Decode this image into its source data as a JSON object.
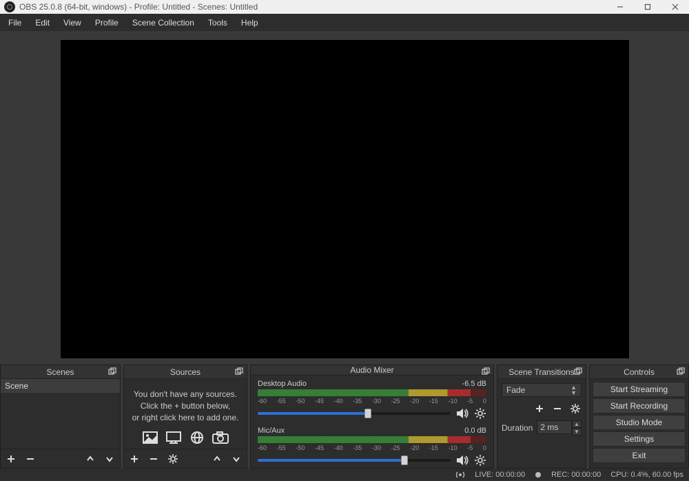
{
  "titlebar": {
    "title": "OBS 25.0.8 (64-bit, windows) - Profile: Untitled - Scenes: Untitled"
  },
  "menu": [
    "File",
    "Edit",
    "View",
    "Profile",
    "Scene Collection",
    "Tools",
    "Help"
  ],
  "panels": {
    "scenes": {
      "title": "Scenes",
      "items": [
        "Scene"
      ]
    },
    "sources": {
      "title": "Sources",
      "empty_lines": [
        "You don't have any sources.",
        "Click the + button below,",
        "or right click here to add one."
      ]
    },
    "mixer": {
      "title": "Audio Mixer",
      "tracks": [
        {
          "name": "Desktop Audio",
          "db": "-6.5 dB",
          "fill_pct": 57,
          "thumb_pct": 57
        },
        {
          "name": "Mic/Aux",
          "db": "0.0 dB",
          "fill_pct": 76,
          "thumb_pct": 76
        }
      ],
      "ticks": [
        "-60",
        "-55",
        "-50",
        "-45",
        "-40",
        "-35",
        "-30",
        "-25",
        "-20",
        "-15",
        "-10",
        "-5",
        "0"
      ]
    },
    "transitions": {
      "title": "Scene Transitions",
      "current": "Fade",
      "duration_label": "Duration",
      "duration_value": "2 ms"
    },
    "controls": {
      "title": "Controls",
      "buttons": [
        "Start Streaming",
        "Start Recording",
        "Studio Mode",
        "Settings",
        "Exit"
      ]
    }
  },
  "status": {
    "live": "LIVE: 00:00:00",
    "rec": "REC: 00:00:00",
    "cpu": "CPU: 0.4%, 60.00 fps"
  }
}
